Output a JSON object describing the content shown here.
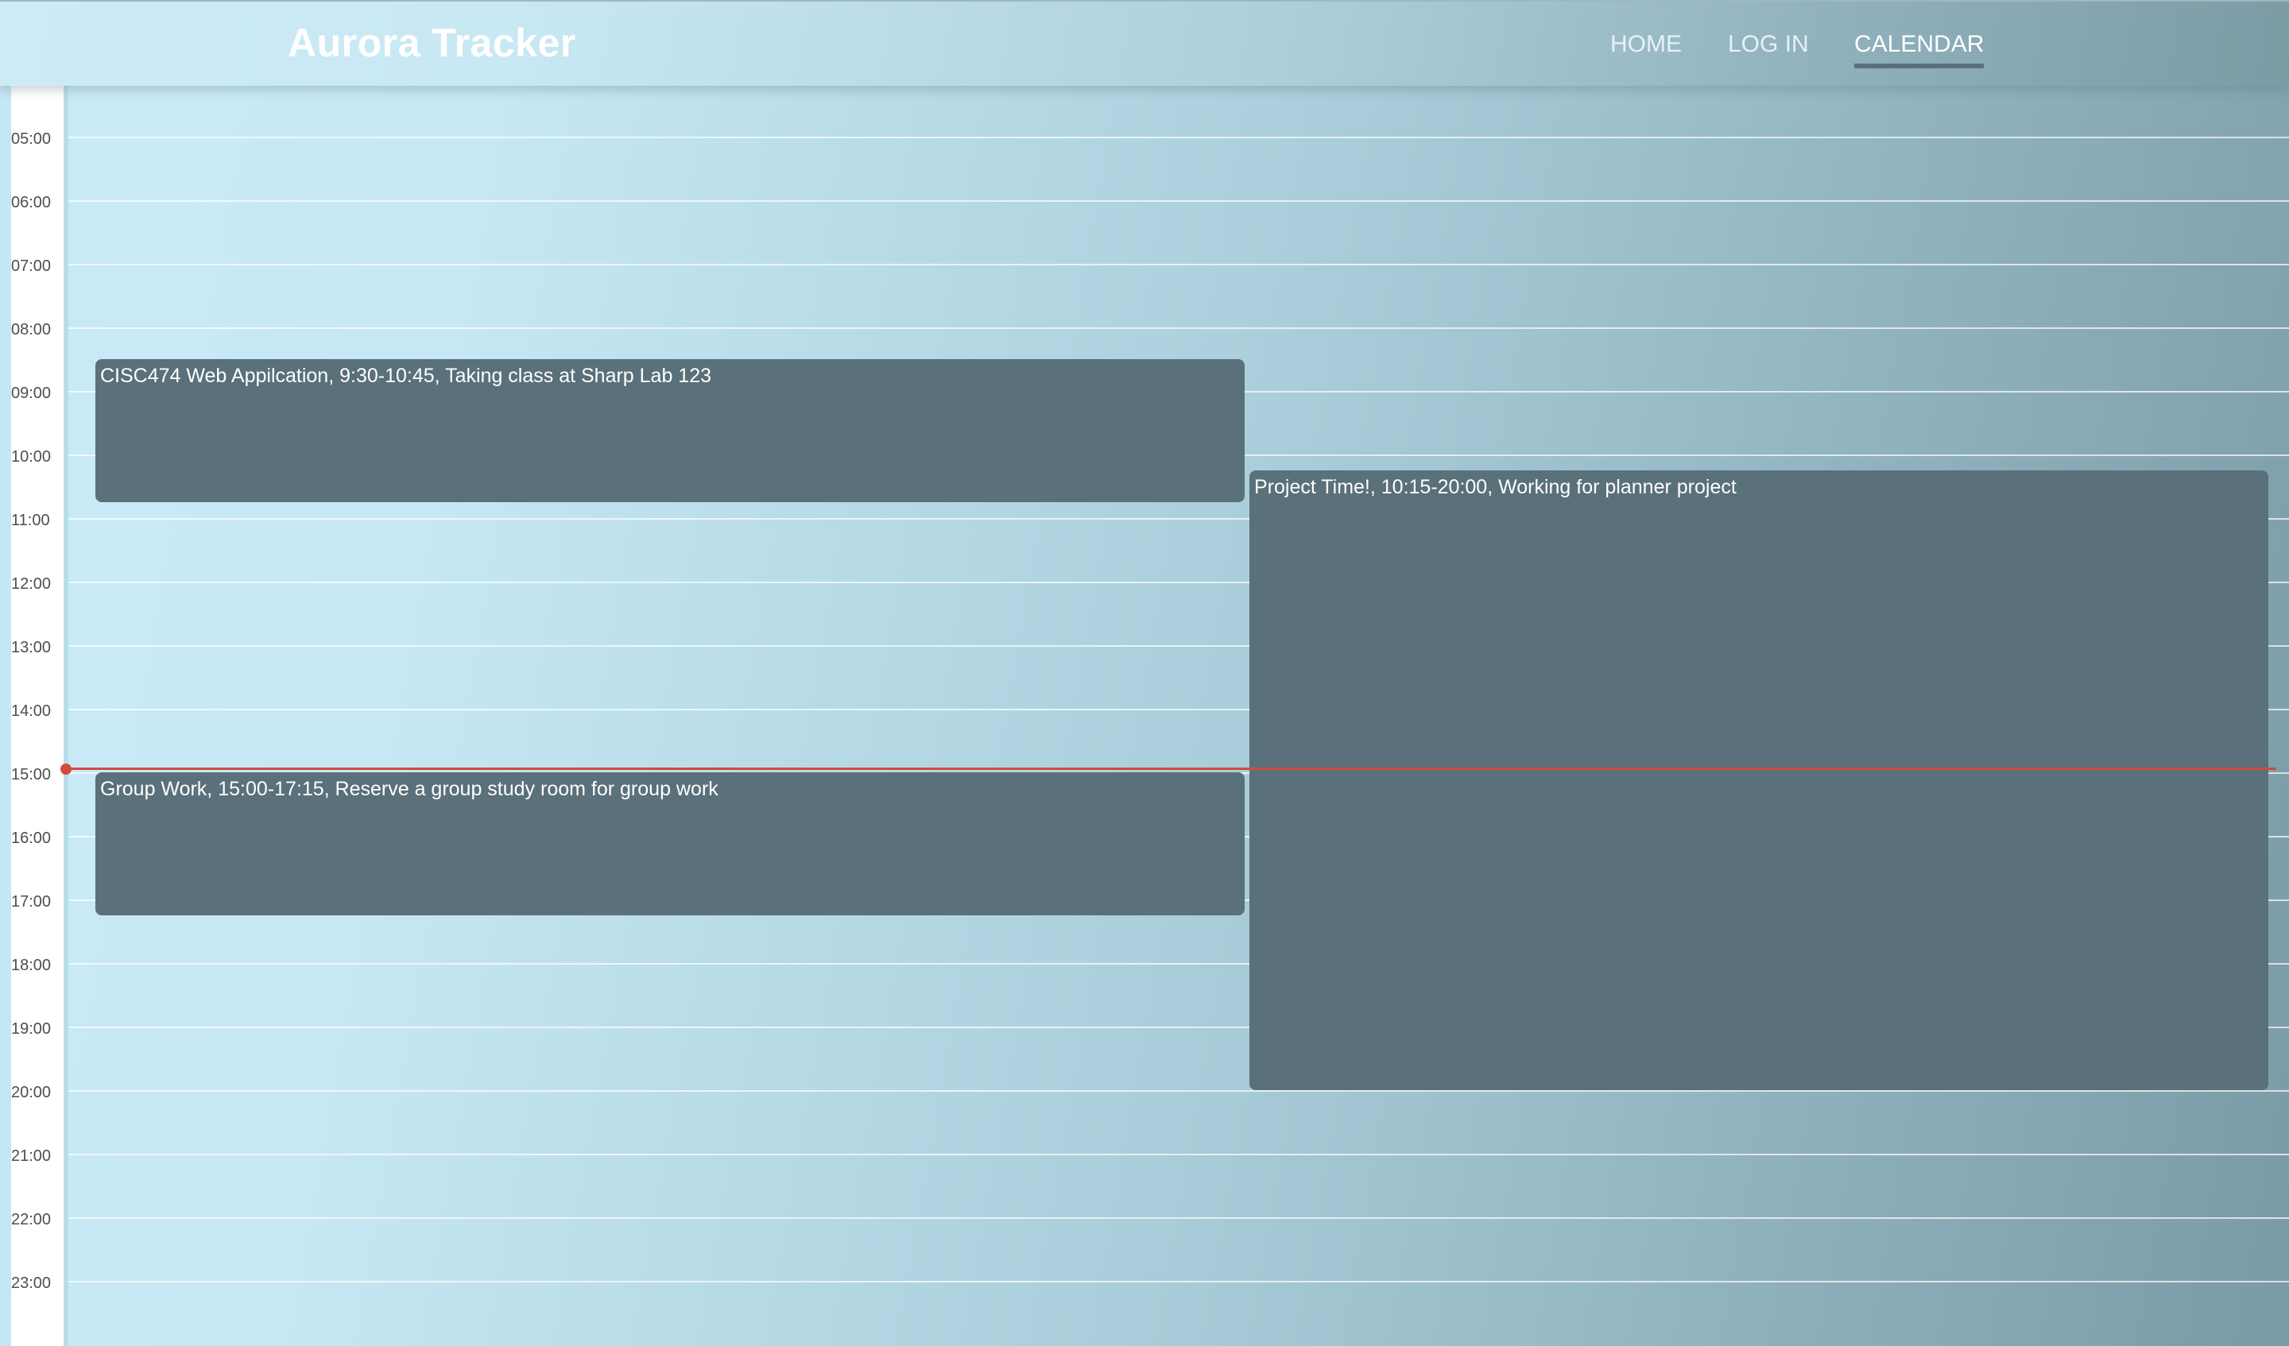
{
  "app": {
    "title": "Aurora Tracker"
  },
  "nav": {
    "items": [
      {
        "label": "HOME"
      },
      {
        "label": "LOG IN"
      },
      {
        "label": "CALENDAR",
        "active": true
      }
    ]
  },
  "calendar": {
    "hours": [
      "05:00",
      "06:00",
      "07:00",
      "08:00",
      "09:00",
      "10:00",
      "11:00",
      "12:00",
      "13:00",
      "14:00",
      "15:00",
      "16:00",
      "17:00",
      "18:00",
      "19:00",
      "20:00",
      "21:00",
      "22:00",
      "23:00"
    ],
    "current_time": "15:00",
    "events": [
      {
        "label": "CISC474 Web Appilcation, 9:30-10:45, Taking class at Sharp Lab 123"
      },
      {
        "label": "Project Time!, 10:15-20:00, Working for planner project"
      },
      {
        "label": "Group Work, 15:00-17:15, Reserve a group study room for group work"
      }
    ]
  },
  "colors": {
    "event_bg": "#5a707a",
    "now_indicator": "#d44a3c",
    "active_underline": "#5a7079"
  }
}
